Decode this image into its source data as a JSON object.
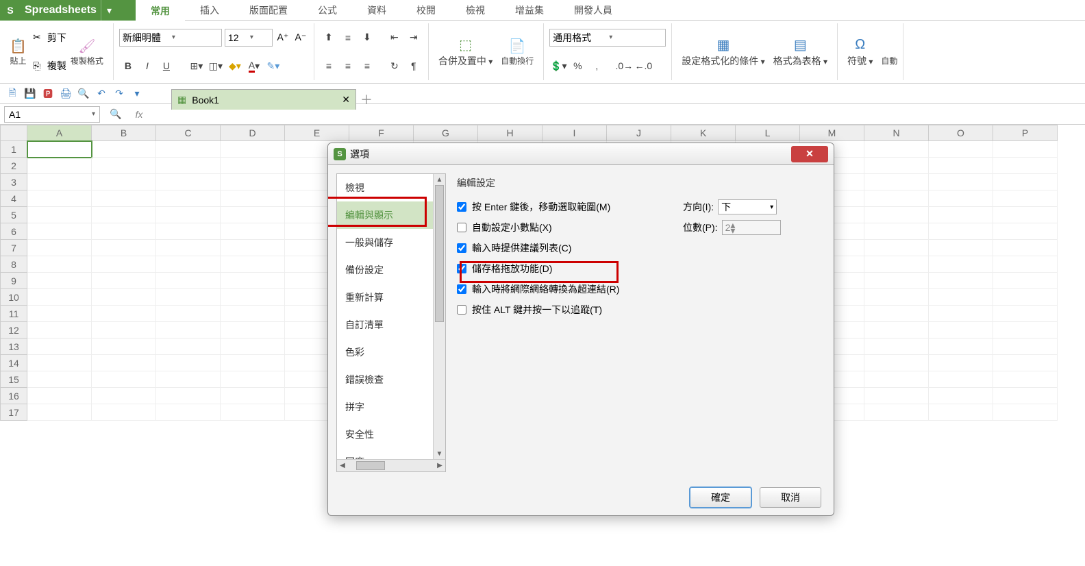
{
  "app": {
    "name": "Spreadsheets"
  },
  "tabs": [
    "常用",
    "插入",
    "版面配置",
    "公式",
    "資料",
    "校閱",
    "檢視",
    "增益集",
    "開發人員"
  ],
  "ribbon": {
    "paste": "貼上",
    "cut": "剪下",
    "copy": "複製",
    "formatPainter": "複製格式",
    "font": "新細明體",
    "size": "12",
    "merge": "合併及置中",
    "wrap": "自動換行",
    "numberFormat": "通用格式",
    "condFmt": "設定格式化的條件",
    "asTable": "格式為表格",
    "symbol": "符號",
    "auto": "自動"
  },
  "doc": {
    "tab": "Book1"
  },
  "cellRef": "A1",
  "cols": [
    "A",
    "B",
    "C",
    "D",
    "E",
    "F",
    "G",
    "H",
    "I",
    "J",
    "K",
    "L",
    "M",
    "N",
    "O",
    "P"
  ],
  "rows": [
    "1",
    "2",
    "3",
    "4",
    "5",
    "6",
    "7",
    "8",
    "9",
    "10",
    "11",
    "12",
    "13",
    "14",
    "15",
    "16",
    "17"
  ],
  "dialog": {
    "title": "選項",
    "side": [
      "檢視",
      "編輯與顯示",
      "一般與儲存",
      "備份設定",
      "重新計算",
      "自訂清單",
      "色彩",
      "錯誤檢查",
      "拼字",
      "安全性",
      "回應"
    ],
    "group": "編輯設定",
    "chk1": "按 Enter 鍵後，移動選取範圍(M)",
    "dirL": "方向(I):",
    "dirV": "下",
    "chk2": "自動設定小數點(X)",
    "digL": "位數(P):",
    "digV": "2",
    "chk3": "輸入時提供建議列表(C)",
    "chk4": "儲存格拖放功能(D)",
    "chk5": "輸入時將網際網絡轉換為超連結(R)",
    "chk6": "按住 ALT 鍵并按一下以追蹤(T)",
    "ok": "確定",
    "cancel": "取消"
  }
}
